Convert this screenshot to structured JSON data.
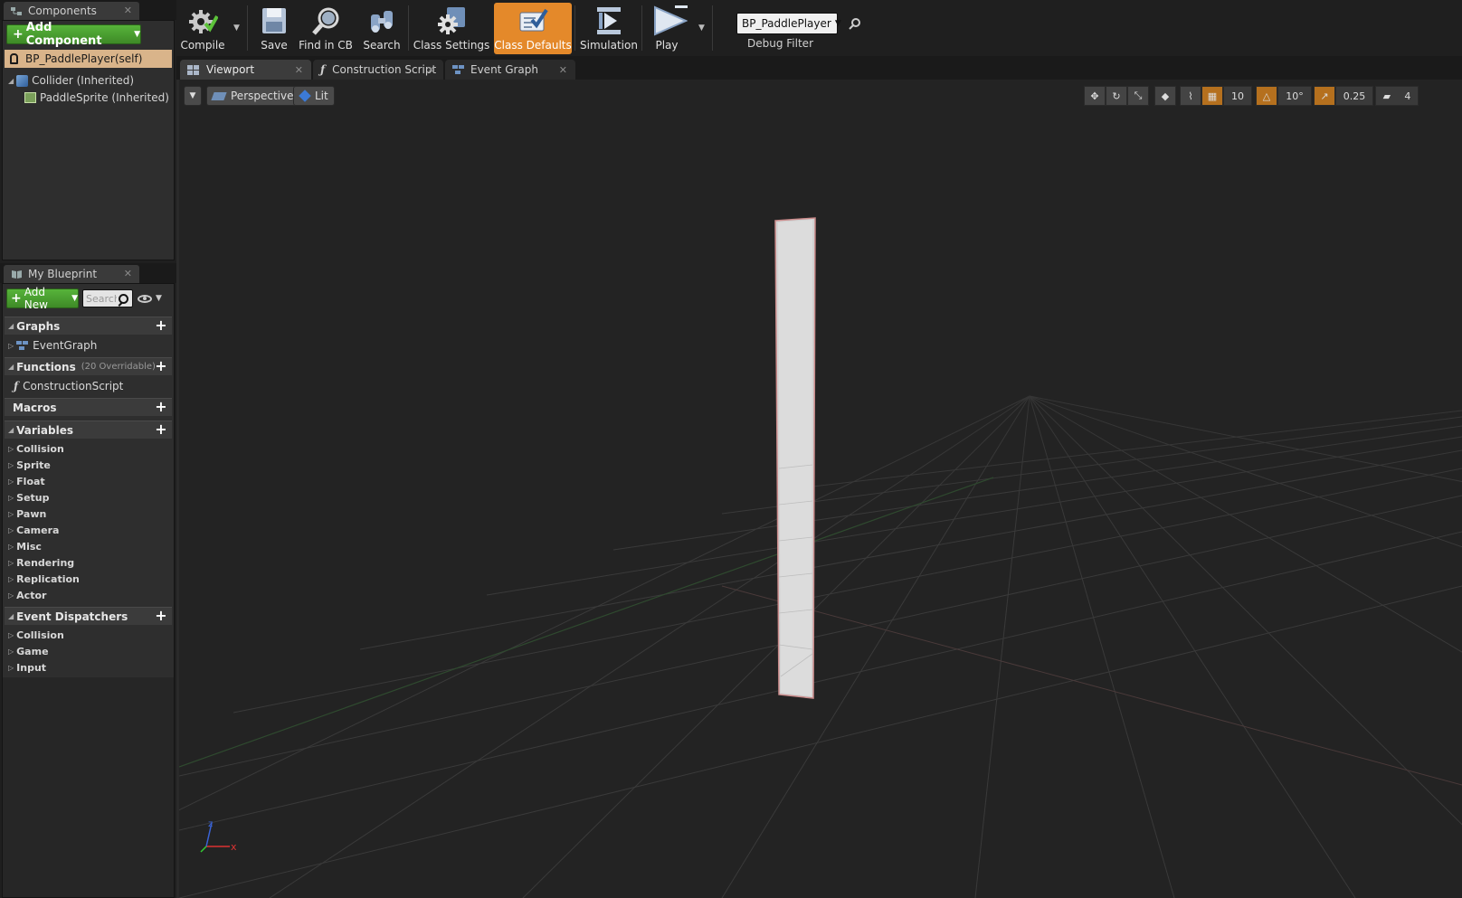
{
  "components_panel": {
    "tab_label": "Components",
    "add_button": "Add Component",
    "self_item": "BP_PaddlePlayer(self)",
    "tree": [
      {
        "label": "Collider (Inherited)"
      },
      {
        "label": "PaddleSprite (Inherited)"
      }
    ]
  },
  "blueprint_panel": {
    "tab_label": "My Blueprint",
    "add_new": "Add New",
    "search_placeholder": "Search",
    "sections": {
      "graphs": {
        "title": "Graphs",
        "items": [
          "EventGraph"
        ]
      },
      "functions": {
        "title": "Functions",
        "note": "(20 Overridable)",
        "items": [
          "ConstructionScript"
        ]
      },
      "macros": {
        "title": "Macros"
      },
      "variables": {
        "title": "Variables",
        "items": [
          "Collision",
          "Sprite",
          "Float",
          "Setup",
          "Pawn",
          "Camera",
          "Misc",
          "Rendering",
          "Replication",
          "Actor"
        ]
      },
      "dispatchers": {
        "title": "Event Dispatchers",
        "items": [
          "Collision",
          "Game",
          "Input"
        ]
      }
    }
  },
  "toolbar": {
    "compile": "Compile",
    "save": "Save",
    "find_in_cb": "Find in CB",
    "search": "Search",
    "class_settings": "Class Settings",
    "class_defaults": "Class Defaults",
    "simulation": "Simulation",
    "play": "Play",
    "debug_object": "BP_PaddlePlayer",
    "debug_filter": "Debug Filter"
  },
  "doc_tabs": {
    "viewport": "Viewport",
    "construction_script": "Construction Script",
    "event_graph": "Event Graph"
  },
  "viewport": {
    "perspective": "Perspective",
    "lit": "Lit",
    "grid_snap": "10",
    "rotation_snap": "10°",
    "scale_snap": "0.25",
    "camera_speed": "4",
    "axis_x": "x",
    "axis_z": "z"
  },
  "colors": {
    "accent_orange": "#e4892a",
    "add_green": "#4fa532",
    "selected_row": "#d9b48a"
  }
}
